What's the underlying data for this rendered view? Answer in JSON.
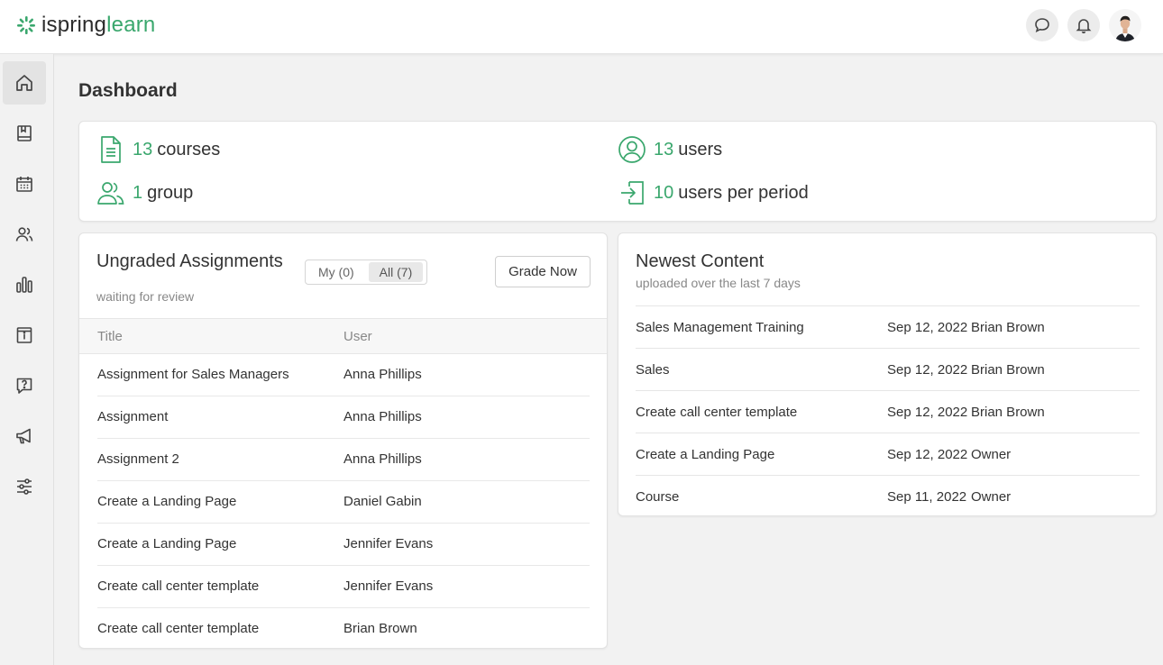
{
  "brand": {
    "part1": "ispring",
    "part2": "learn",
    "accent": "#3aa76d"
  },
  "topbar": {
    "icons": [
      "chat-icon",
      "bell-icon",
      "avatar"
    ]
  },
  "sidebar": {
    "items": [
      {
        "name": "home-icon",
        "active": true
      },
      {
        "name": "book-icon"
      },
      {
        "name": "calendar-icon"
      },
      {
        "name": "users-icon"
      },
      {
        "name": "reports-icon"
      },
      {
        "name": "info-icon"
      },
      {
        "name": "help-icon"
      },
      {
        "name": "megaphone-icon"
      },
      {
        "name": "settings-sliders-icon"
      }
    ]
  },
  "page": {
    "title": "Dashboard"
  },
  "stats": {
    "courses": {
      "num": "13",
      "label": "courses"
    },
    "users": {
      "num": "13",
      "label": "users"
    },
    "groups": {
      "num": "1",
      "label": "group"
    },
    "users_period": {
      "num": "10",
      "label": "users per period"
    }
  },
  "ungraded": {
    "title": "Ungraded Assignments",
    "subtitle": "waiting for review",
    "toggle": {
      "my": "My (0)",
      "all": "All (7)"
    },
    "grade_button": "Grade Now",
    "columns": {
      "title": "Title",
      "user": "User"
    },
    "rows": [
      {
        "title": "Assignment for Sales Managers",
        "user": "Anna Phillips"
      },
      {
        "title": "Assignment",
        "user": "Anna Phillips"
      },
      {
        "title": "Assignment 2",
        "user": "Anna Phillips"
      },
      {
        "title": "Create a Landing Page",
        "user": "Daniel Gabin"
      },
      {
        "title": "Create a Landing Page",
        "user": "Jennifer Evans"
      },
      {
        "title": "Create call center template",
        "user": "Jennifer Evans"
      },
      {
        "title": "Create call center template",
        "user": "Brian Brown"
      }
    ]
  },
  "newest": {
    "title": "Newest Content",
    "subtitle": "uploaded over the last 7 days",
    "rows": [
      {
        "name": "Sales Management Training",
        "date": "Sep 12, 2022",
        "author": "Brian Brown"
      },
      {
        "name": "Sales",
        "date": "Sep 12, 2022",
        "author": "Brian Brown"
      },
      {
        "name": "Create call center template",
        "date": "Sep 12, 2022",
        "author": "Brian Brown"
      },
      {
        "name": "Create a Landing Page",
        "date": "Sep 12, 2022",
        "author": "Owner"
      },
      {
        "name": "Course",
        "date": "Sep 11, 2022",
        "author": "Owner"
      }
    ]
  }
}
